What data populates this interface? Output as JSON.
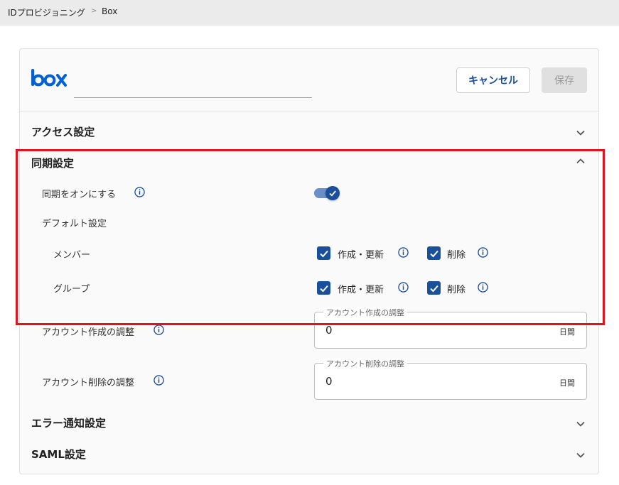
{
  "breadcrumb": {
    "parent": "IDプロビジョニング",
    "separator": ">",
    "current": "Box"
  },
  "header": {
    "logo_text": "box",
    "cancel_label": "キャンセル",
    "save_label": "保存"
  },
  "sections": {
    "access": {
      "title": "アクセス設定",
      "expanded": false
    },
    "sync": {
      "title": "同期設定",
      "expanded": true,
      "enable_label": "同期をオンにする",
      "enable_on": true,
      "default_label": "デフォルト設定",
      "member": {
        "label": "メンバー",
        "create_update_label": "作成・更新",
        "create_update_checked": true,
        "delete_label": "削除",
        "delete_checked": true
      },
      "group": {
        "label": "グループ",
        "create_update_label": "作成・更新",
        "create_update_checked": true,
        "delete_label": "削除",
        "delete_checked": true
      },
      "account_create": {
        "label": "アカウント作成の調整",
        "field_legend": "アカウント作成の調整",
        "value": "0",
        "unit": "日間"
      },
      "account_delete": {
        "label": "アカウント削除の調整",
        "field_legend": "アカウント削除の調整",
        "value": "0",
        "unit": "日間"
      }
    },
    "error": {
      "title": "エラー通知設定",
      "expanded": false
    },
    "saml": {
      "title": "SAML設定",
      "expanded": false
    }
  },
  "colors": {
    "brand_blue": "#1a4f9c",
    "highlight_red": "#e0141e",
    "box_logo_blue": "#0061d5"
  },
  "icons": [
    "info-icon",
    "chevron-down-icon",
    "chevron-up-icon",
    "check-icon"
  ]
}
